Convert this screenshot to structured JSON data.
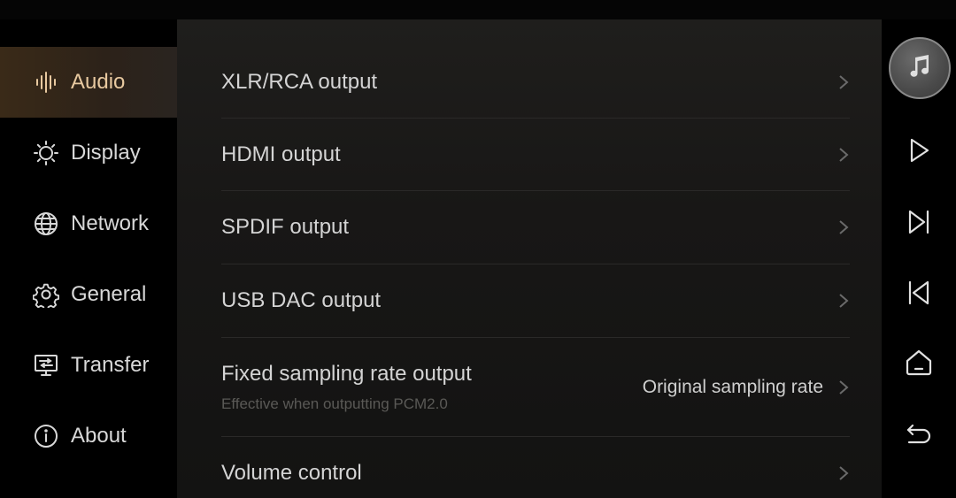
{
  "sidebar": {
    "items": [
      {
        "label": "Audio",
        "icon": "audio-waveform-icon",
        "active": true
      },
      {
        "label": "Display",
        "icon": "brightness-icon",
        "active": false
      },
      {
        "label": "Network",
        "icon": "globe-icon",
        "active": false
      },
      {
        "label": "General",
        "icon": "gear-icon",
        "active": false
      },
      {
        "label": "Transfer",
        "icon": "monitor-transfer-icon",
        "active": false
      },
      {
        "label": "About",
        "icon": "info-icon",
        "active": false
      }
    ]
  },
  "settings": {
    "rows": [
      {
        "label": "XLR/RCA output"
      },
      {
        "label": "HDMI output"
      },
      {
        "label": "SPDIF output"
      },
      {
        "label": "USB DAC output"
      },
      {
        "label": "Fixed sampling rate output",
        "sublabel": "Effective when outputting PCM2.0",
        "value": "Original sampling rate"
      },
      {
        "label": "Volume control"
      }
    ]
  },
  "rail": {
    "buttons": [
      "music-note-icon",
      "play-icon",
      "next-track-icon",
      "previous-track-icon",
      "home-icon",
      "back-icon"
    ]
  },
  "colors": {
    "active_bg": "#3a2a18",
    "active_text": "#e8c9a0",
    "text": "#d4d4d4",
    "subtext": "#5a5956",
    "background": "#000000"
  }
}
